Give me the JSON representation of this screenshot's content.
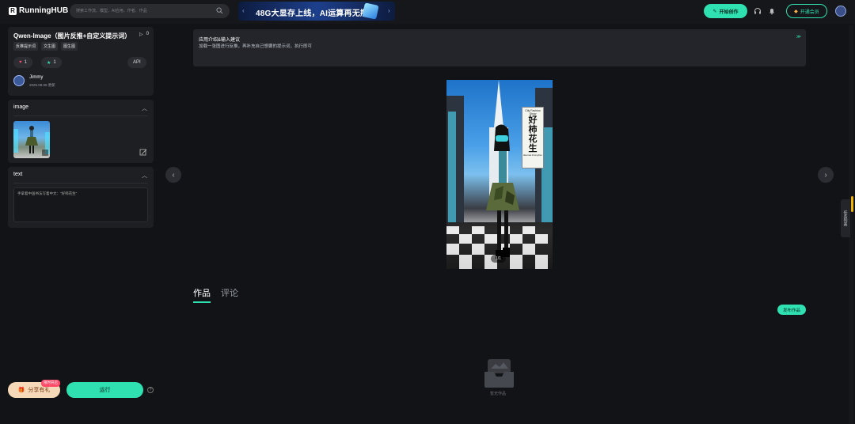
{
  "header": {
    "logo": "RunningHUB",
    "search_placeholder": "搜索工作流、模型、AI应用、作者、作品",
    "banner_text": "48G大显存上线，AI运算再无瓶颈",
    "start_button": "开始创作",
    "vip_button": "开通会员"
  },
  "app": {
    "title": "Qwen-Image（图片反推+自定义提示词）",
    "play_count": "0",
    "tags": [
      "反推提示词",
      "文生图",
      "图生图"
    ],
    "likes": "1",
    "favorites": "1",
    "api_label": "API",
    "author": "Jimmy",
    "updated": "2025.08.06 更新"
  },
  "image_section": {
    "title": "image"
  },
  "text_section": {
    "title": "text",
    "value": "手拿着中国书法写着中文：\"好柿花生\""
  },
  "footer": {
    "share_label": "分享有礼",
    "share_badge": "限时开启",
    "run_label": "运行",
    "help": "?"
  },
  "intro": {
    "title": "应用介绍&输入建议",
    "desc": "加载一张图进行反推，再补充自己想要的提示词，执行即可"
  },
  "gallery": {
    "counter": "1/1",
    "sign_title": "City Fashion Show",
    "sign_chars": [
      "好",
      "柿",
      "花",
      "生"
    ],
    "sign_foot": "Eternal Jimmyfan"
  },
  "tabs": [
    {
      "label": "作品"
    },
    {
      "label": "评论"
    }
  ],
  "works": {
    "publish_label": "发布作品",
    "empty_text": "暂无作品"
  },
  "side_tab": "任务列表",
  "colors": {
    "accent": "#2fe0b0",
    "background": "#121316",
    "panel": "#1e1f23"
  }
}
